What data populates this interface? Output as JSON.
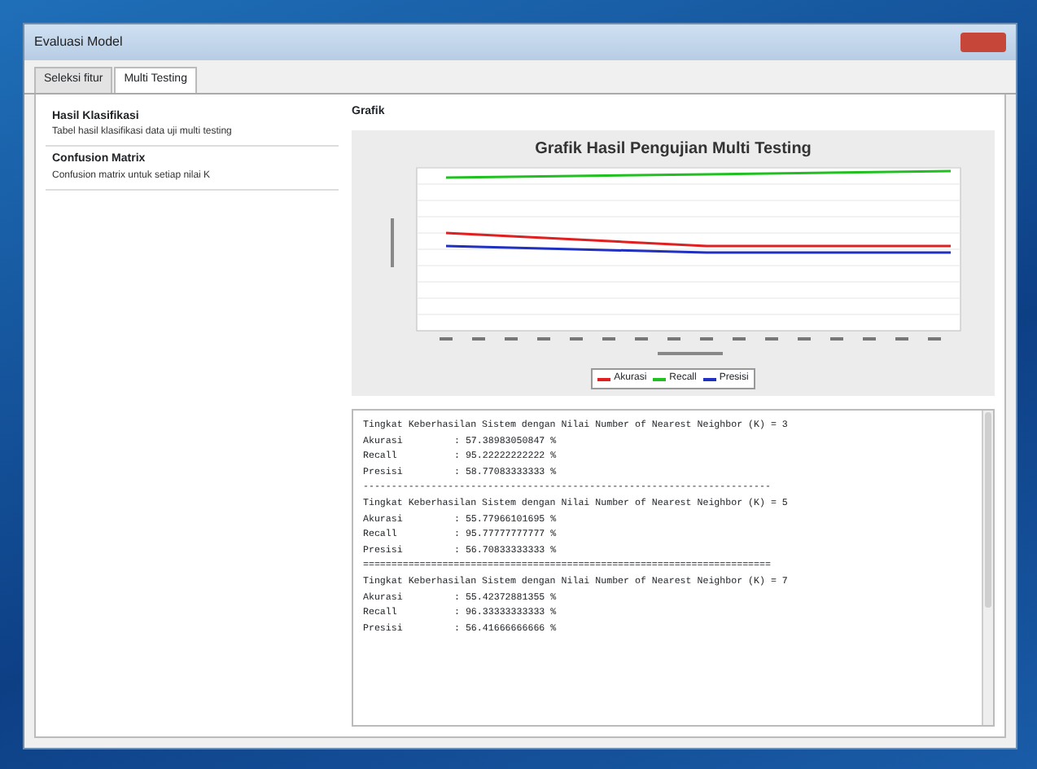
{
  "window": {
    "title": "Evaluasi Model"
  },
  "tabs": [
    {
      "label": "Seleksi fitur",
      "selected": false
    },
    {
      "label": "Multi Testing",
      "selected": true
    }
  ],
  "sidebar": {
    "items": [
      {
        "title": "Hasil Klasifikasi",
        "subtitle": "Tabel hasil klasifikasi data uji multi testing"
      },
      {
        "title": "Confusion Matrix",
        "subtitle": "Confusion matrix untuk setiap nilai K"
      }
    ]
  },
  "panel": {
    "title": "Grafik",
    "chart": {
      "title": "Grafik Hasil Pengujian Multi Testing",
      "legend": [
        {
          "name": "Akurasi",
          "color": "#e02020"
        },
        {
          "name": "Recall",
          "color": "#20c020"
        },
        {
          "name": "Presisi",
          "color": "#2030c0"
        }
      ]
    },
    "results": [
      {
        "kind": "heading",
        "text": "Tingkat Keberhasilan Sistem dengan Nilai Number of Nearest Neighbor (K) = 3"
      },
      {
        "kind": "row",
        "label": "Akurasi",
        "value": ": 57.38983050847 %"
      },
      {
        "kind": "row",
        "label": "Recall",
        "value": ": 95.22222222222 %"
      },
      {
        "kind": "row",
        "label": "Presisi",
        "value": ": 58.77083333333 %"
      },
      {
        "kind": "rule",
        "text": "------------------------------------------------------------------------"
      },
      {
        "kind": "heading",
        "text": "Tingkat Keberhasilan Sistem dengan Nilai Number of Nearest Neighbor (K) = 5"
      },
      {
        "kind": "row",
        "label": "Akurasi",
        "value": ": 55.77966101695 %"
      },
      {
        "kind": "row",
        "label": "Recall",
        "value": ": 95.77777777777 %"
      },
      {
        "kind": "row",
        "label": "Presisi",
        "value": ": 56.70833333333 %"
      },
      {
        "kind": "rule",
        "text": "========================================================================"
      },
      {
        "kind": "heading",
        "text": "Tingkat Keberhasilan Sistem dengan Nilai Number of Nearest Neighbor (K) = 7"
      },
      {
        "kind": "row",
        "label": "Akurasi",
        "value": ": 55.42372881355 %"
      },
      {
        "kind": "row",
        "label": "Recall",
        "value": ": 96.33333333333 %"
      },
      {
        "kind": "row",
        "label": "Presisi",
        "value": ": 56.41666666666 %"
      }
    ]
  }
}
